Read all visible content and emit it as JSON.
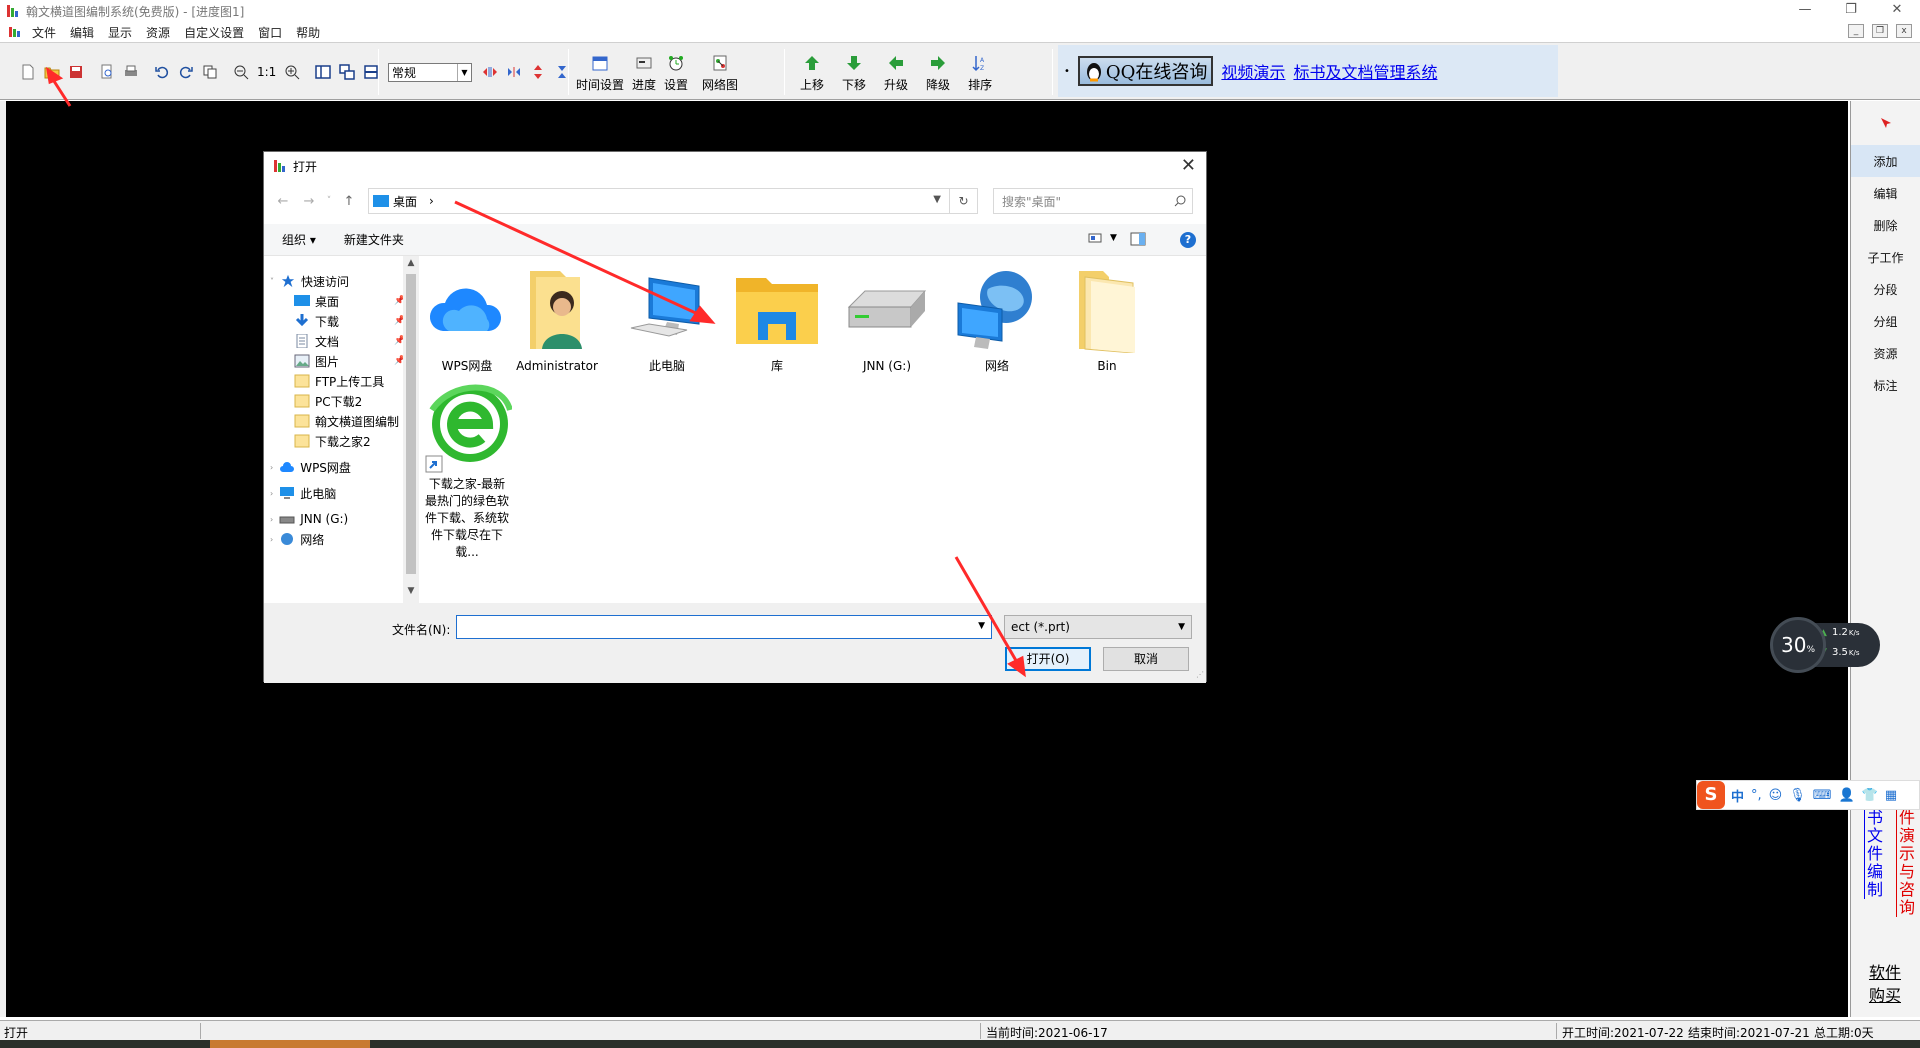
{
  "app": {
    "title": "翰文横道图编制系统(免费版) - [进度图1]",
    "window_controls": [
      "—",
      "❐",
      "✕"
    ]
  },
  "menu": {
    "items": [
      "文件",
      "编辑",
      "显示",
      "资源",
      "自定义设置",
      "窗口",
      "帮助"
    ]
  },
  "toolbar": {
    "style_select": "常规",
    "zoom_label": "1:1",
    "buttons1": [
      "时间设置",
      "进度",
      "设置",
      "网络图"
    ],
    "buttons2": [
      "上移",
      "下移",
      "升级",
      "降级",
      "排序"
    ],
    "qq_button": "QQ在线咨询",
    "link_video": "视频演示",
    "link_docs": "标书及文档管理系统",
    "bullet": "•"
  },
  "right_panel": {
    "items": [
      "添加",
      "编辑",
      "删除",
      "子工作",
      "分段",
      "分组",
      "资源",
      "标注"
    ],
    "link_blue": "标书文件编制",
    "link_red": "软件演示与咨询",
    "buy": "软件购买"
  },
  "status": {
    "left": "打开",
    "current_time": "当前时间:2021-06-17",
    "start_time": "开工时间:2021-07-22",
    "end_time": "结束时间:2021-07-21",
    "total": "总工期:0天"
  },
  "dialog": {
    "title": "打开",
    "path": "桌面",
    "path_sep": "›",
    "search_placeholder": "搜索\"桌面\"",
    "cmd_organize": "组织 ▾",
    "cmd_new_folder": "新建文件夹",
    "nav": [
      {
        "label": "快速访问"
      },
      {
        "label": "桌面"
      },
      {
        "label": "下载"
      },
      {
        "label": "文档"
      },
      {
        "label": "图片"
      },
      {
        "label": "FTP上传工具"
      },
      {
        "label": "PC下载2"
      },
      {
        "label": "翰文横道图编制"
      },
      {
        "label": "下载之家2"
      },
      {
        "label": "WPS网盘"
      },
      {
        "label": "此电脑"
      },
      {
        "label": "JNN (G:)"
      },
      {
        "label": "网络"
      }
    ],
    "files": [
      {
        "label": "WPS网盘",
        "icon": "cloud-icon"
      },
      {
        "label": "Administrator",
        "icon": "user-folder-icon"
      },
      {
        "label": "此电脑",
        "icon": "computer-icon"
      },
      {
        "label": "库",
        "icon": "library-icon"
      },
      {
        "label": "JNN (G:)",
        "icon": "drive-icon"
      },
      {
        "label": "网络",
        "icon": "network-icon"
      },
      {
        "label": "Bin",
        "icon": "folder-icon"
      },
      {
        "label": "下载之家-最新最热门的绿色软件下载、系统软件下载尽在下载...",
        "icon": "ie-shortcut-icon"
      }
    ],
    "filename_label": "文件名(N):",
    "filename_value": "",
    "filetype": "ect (*.prt)",
    "open_btn": "打开(O)",
    "cancel_btn": "取消"
  },
  "speed_widget": {
    "percent": "30",
    "percent_unit": "%",
    "up": "1.2",
    "down": "3.5",
    "unit": "K/s"
  },
  "ime": {
    "logo": "S",
    "mode": "中"
  },
  "colors": {
    "accent_blue": "#0078d7",
    "link_blue": "#0000ee",
    "link_red": "#e00000",
    "arrow_red": "#ff2a2a"
  }
}
